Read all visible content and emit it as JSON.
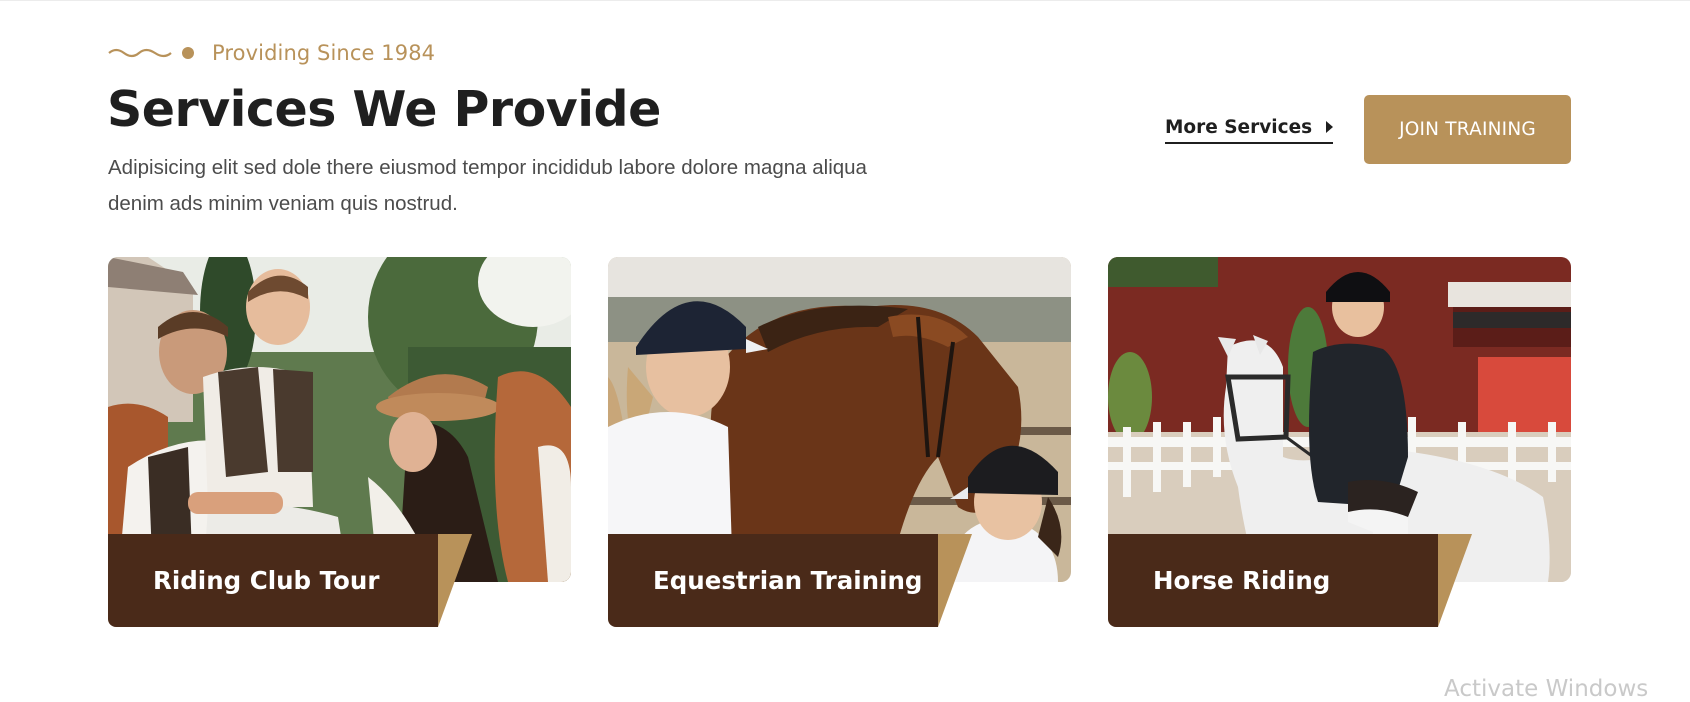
{
  "section": {
    "tagline": "Providing Since 1984",
    "title": "Services We Provide",
    "description": "Adipisicing elit sed dole there eiusmod tempor incididub labore dolore magna aliqua denim ads minim veniam quis nostrud.",
    "more_link_label": "More Services",
    "join_button_label": "JOIN TRAINING"
  },
  "cards": [
    {
      "title": "Riding Club Tour",
      "image": "family-with-horse-photo"
    },
    {
      "title": "Equestrian Training",
      "image": "girls-with-horse-photo"
    },
    {
      "title": "Horse Riding",
      "image": "rider-on-white-horse-photo"
    }
  ],
  "colors": {
    "accent": "#b8925a",
    "dark_brown": "#4a2a19",
    "heading": "#1f1f1f",
    "body_text": "#4c4c4c"
  },
  "icons": [
    "wave-icon",
    "dot-icon",
    "caret-right-icon"
  ],
  "watermark": "Activate Windows"
}
